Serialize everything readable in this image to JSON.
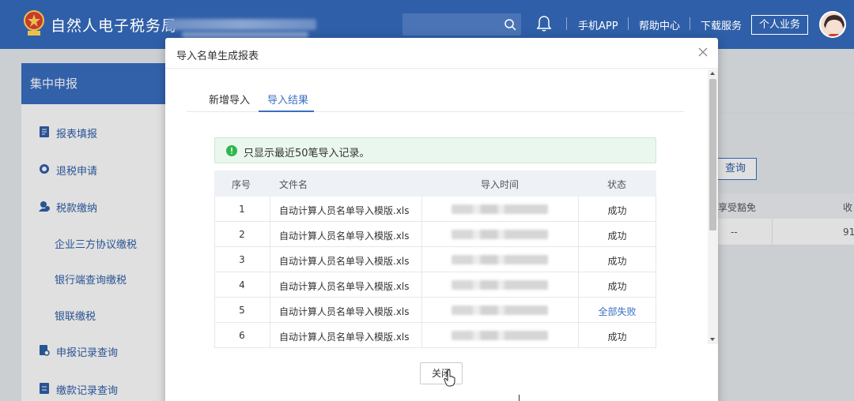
{
  "header": {
    "site_title": "自然人电子税务局",
    "nav": [
      "手机APP",
      "帮助中心",
      "下载服务"
    ],
    "personal_button": "个人业务"
  },
  "sidebar": {
    "title": "集中申报",
    "items": [
      {
        "label": "报表填报",
        "icon": "report-icon"
      },
      {
        "label": "退税申请",
        "icon": "refund-icon"
      },
      {
        "label": "税款缴纳",
        "icon": "payment-icon"
      }
    ],
    "subitems": [
      "企业三方协议缴税",
      "银行端查询缴税",
      "银联缴税"
    ],
    "items_bottom": [
      {
        "label": "申报记录查询",
        "icon": "record-icon"
      },
      {
        "label": "缴款记录查询",
        "icon": "receipt-icon"
      }
    ]
  },
  "background": {
    "query_button": "查询",
    "col_header": "享受豁免",
    "col_header_2": "收",
    "cell_dash": "--",
    "cell_value": "91"
  },
  "modal": {
    "title": "导入名单生成报表",
    "tabs": [
      "新增导入",
      "导入结果"
    ],
    "active_tab": "导入结果",
    "notice": "只显示最近50笔导入记录。",
    "columns": [
      "序号",
      "文件名",
      "导入时间",
      "状态"
    ],
    "rows": [
      {
        "seq": "1",
        "file": "自动计算人员名单导入模版.xls",
        "status": "成功"
      },
      {
        "seq": "2",
        "file": "自动计算人员名单导入模版.xls",
        "status": "成功"
      },
      {
        "seq": "3",
        "file": "自动计算人员名单导入模版.xls",
        "status": "成功"
      },
      {
        "seq": "4",
        "file": "自动计算人员名单导入模版.xls",
        "status": "成功"
      },
      {
        "seq": "5",
        "file": "自动计算人员名单导入模版.xls",
        "status": "全部失败"
      },
      {
        "seq": "6",
        "file": "自动计算人员名单导入模版.xls",
        "status": "成功"
      }
    ],
    "close_button": "关闭"
  },
  "colors": {
    "header_bg": "#2f5fa8",
    "accent": "#3a6fc2",
    "notice_bg": "#eaf7ee",
    "success_icon": "#2db84d"
  }
}
